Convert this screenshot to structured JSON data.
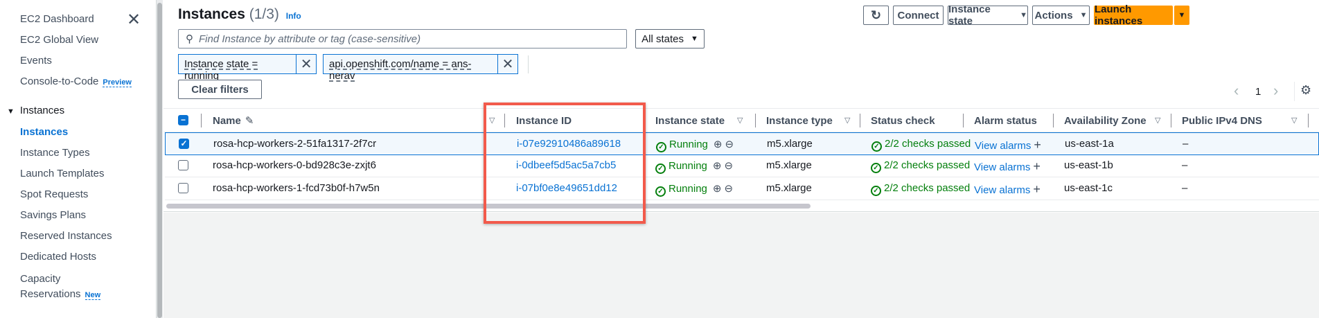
{
  "sidebar": {
    "items": [
      {
        "label": "EC2 Dashboard"
      },
      {
        "label": "EC2 Global View"
      },
      {
        "label": "Events"
      },
      {
        "label": "Console-to-Code",
        "badge": "Preview"
      }
    ],
    "section": "Instances",
    "section_items": [
      {
        "label": "Instances",
        "active": true
      },
      {
        "label": "Instance Types"
      },
      {
        "label": "Launch Templates"
      },
      {
        "label": "Spot Requests"
      },
      {
        "label": "Savings Plans"
      },
      {
        "label": "Reserved Instances"
      },
      {
        "label": "Dedicated Hosts"
      },
      {
        "label": "Capacity",
        "label2": "Reservations",
        "badge": "New"
      }
    ]
  },
  "header": {
    "title": "Instances",
    "count": "(1/3)",
    "info": "Info"
  },
  "toolbar": {
    "connect": "Connect",
    "instance_state": "Instance state",
    "actions": "Actions",
    "launch": "Launch instances"
  },
  "search": {
    "placeholder": "Find Instance by attribute or tag (case-sensitive)",
    "state_filter": "All states"
  },
  "filters": [
    "Instance state = running",
    "api.openshift.com/name = ans-nerav"
  ],
  "clear_filters": "Clear filters",
  "pagination": {
    "page": "1"
  },
  "table": {
    "columns": [
      "Name",
      "Instance ID",
      "Instance state",
      "Instance type",
      "Status check",
      "Alarm status",
      "Availability Zone",
      "Public IPv4 DNS"
    ],
    "rows": [
      {
        "selected": true,
        "name": "rosa-hcp-workers-2-51fa1317-2f7cr",
        "id": "i-07e92910486a89618",
        "state": "Running",
        "type": "m5.xlarge",
        "status": "2/2 checks passed",
        "alarm": "View alarms",
        "az": "us-east-1a",
        "dns": "–"
      },
      {
        "selected": false,
        "name": "rosa-hcp-workers-0-bd928c3e-zxjt6",
        "id": "i-0dbeef5d5ac5a7cb5",
        "state": "Running",
        "type": "m5.xlarge",
        "status": "2/2 checks passed",
        "alarm": "View alarms",
        "az": "us-east-1b",
        "dns": "–"
      },
      {
        "selected": false,
        "name": "rosa-hcp-workers-1-fcd73b0f-h7w5n",
        "id": "i-07bf0e8e49651dd12",
        "state": "Running",
        "type": "m5.xlarge",
        "status": "2/2 checks passed",
        "alarm": "View alarms",
        "az": "us-east-1c",
        "dns": "–"
      }
    ]
  },
  "colors": {
    "accent": "#0972d3",
    "primary_button": "#ff9900",
    "success": "#037f0c",
    "highlight_box": "#f25a4b"
  }
}
